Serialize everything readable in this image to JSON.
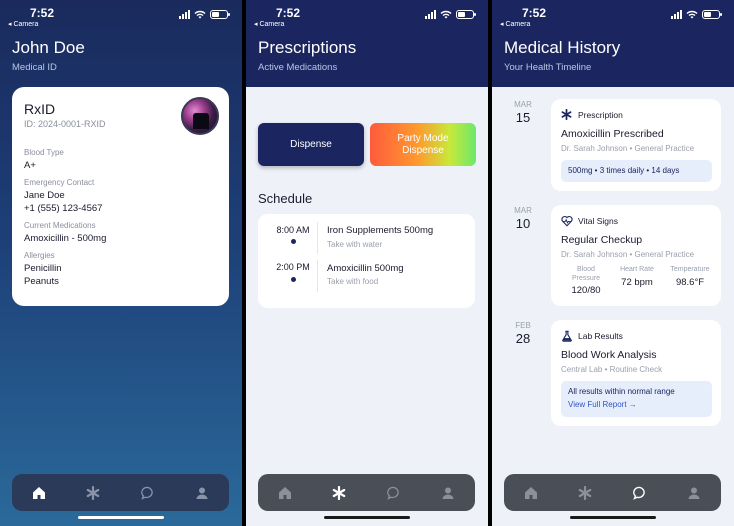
{
  "status": {
    "time": "7:52",
    "back": "◂ Camera"
  },
  "screen1": {
    "title": "John Doe",
    "subtitle": "Medical ID",
    "card": {
      "heading": "RxID",
      "id": "ID: 2024-0001-RXID",
      "blood_type_label": "Blood Type",
      "blood_type": "A+",
      "emergency_label": "Emergency Contact",
      "emergency_name": "Jane Doe",
      "emergency_phone": "+1 (555) 123-4567",
      "meds_label": "Current Medications",
      "meds": "Amoxicillin - 500mg",
      "allergies_label": "Allergies",
      "allergy1": "Penicillin",
      "allergy2": "Peanuts"
    }
  },
  "screen2": {
    "title": "Prescriptions",
    "subtitle": "Active Medications",
    "dispense": "Dispense",
    "party_line1": "Party Mode",
    "party_line2": "Dispense",
    "schedule_title": "Schedule",
    "items": [
      {
        "time": "8:00 AM",
        "name": "Iron Supplements 500mg",
        "note": "Take with water"
      },
      {
        "time": "2:00 PM",
        "name": "Amoxicillin 500mg",
        "note": "Take with food"
      }
    ]
  },
  "screen3": {
    "title": "Medical History",
    "subtitle": "Your Health Timeline",
    "entries": [
      {
        "month": "MAR",
        "day": "15",
        "type": "Prescription",
        "title": "Amoxicillin Prescribed",
        "doc": "Dr. Sarah Johnson • General Practice",
        "pill": "500mg • 3 times daily • 14 days"
      },
      {
        "month": "MAR",
        "day": "10",
        "type": "Vital Signs",
        "title": "Regular Checkup",
        "doc": "Dr. Sarah Johnson • General Practice",
        "vitals": [
          {
            "label1": "Blood",
            "label2": "Pressure",
            "value": "120/80"
          },
          {
            "label1": "Heart Rate",
            "label2": "",
            "value": "72 bpm"
          },
          {
            "label1": "Temperature",
            "label2": "",
            "value": "98.6°F"
          }
        ]
      },
      {
        "month": "FEB",
        "day": "28",
        "type": "Lab Results",
        "title": "Blood Work Analysis",
        "doc": "Central Lab • Routine Check",
        "pill": "All results within normal range",
        "link": "View Full Report →"
      }
    ]
  },
  "tabs": {
    "icons": [
      "home-icon",
      "asterisk-icon",
      "chat-icon",
      "person-icon"
    ],
    "active": [
      "home-icon",
      "asterisk-icon",
      "chat-icon"
    ]
  }
}
